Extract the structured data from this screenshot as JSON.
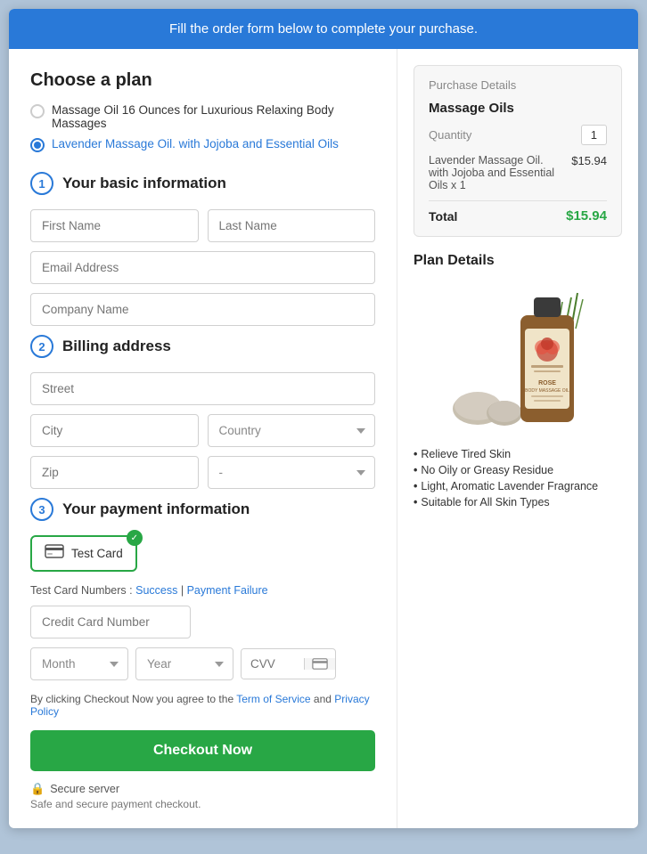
{
  "banner": {
    "text": "Fill the order form below to complete your purchase."
  },
  "left": {
    "choose_plan_title": "Choose a plan",
    "plans": [
      {
        "id": "plan1",
        "label": "Massage Oil 16 Ounces for Luxurious Relaxing Body Massages",
        "selected": false
      },
      {
        "id": "plan2",
        "label": "Lavender Massage Oil. with Jojoba and Essential Oils",
        "selected": true
      }
    ],
    "sections": [
      {
        "number": "1",
        "title": "Your basic information"
      },
      {
        "number": "2",
        "title": "Billing address"
      },
      {
        "number": "3",
        "title": "Your payment information"
      }
    ],
    "fields": {
      "first_name_placeholder": "First Name",
      "last_name_placeholder": "Last Name",
      "email_placeholder": "Email Address",
      "company_placeholder": "Company Name",
      "street_placeholder": "Street",
      "city_placeholder": "City",
      "country_placeholder": "Country",
      "zip_placeholder": "Zip",
      "state_placeholder": "-"
    },
    "payment": {
      "card_label": "Test Card",
      "test_card_label": "Test Card Numbers :",
      "success_link": "Success",
      "failure_link": "Payment Failure",
      "credit_card_placeholder": "Credit Card Number",
      "month_placeholder": "Month",
      "year_placeholder": "Year",
      "cvv_placeholder": "CVV"
    },
    "terms": {
      "text_before": "By clicking Checkout Now you agree to the ",
      "tos_link": "Term of Service",
      "text_between": " and ",
      "privacy_link": "Privacy Policy"
    },
    "checkout_btn": "Checkout Now",
    "secure_server": "Secure server",
    "safe_text": "Safe and secure payment checkout."
  },
  "right": {
    "purchase_details_title": "Purchase Details",
    "product_name": "Massage Oils",
    "quantity_label": "Quantity",
    "quantity_value": "1",
    "product_line": "Lavender Massage Oil. with Jojoba and Essential Oils x 1",
    "product_price": "$15.94",
    "total_label": "Total",
    "total_price": "$15.94",
    "plan_details_title": "Plan Details",
    "features": [
      "Relieve Tired Skin",
      "No Oily or Greasy Residue",
      "Light, Aromatic Lavender Fragrance",
      "Suitable for All Skin Types"
    ]
  }
}
